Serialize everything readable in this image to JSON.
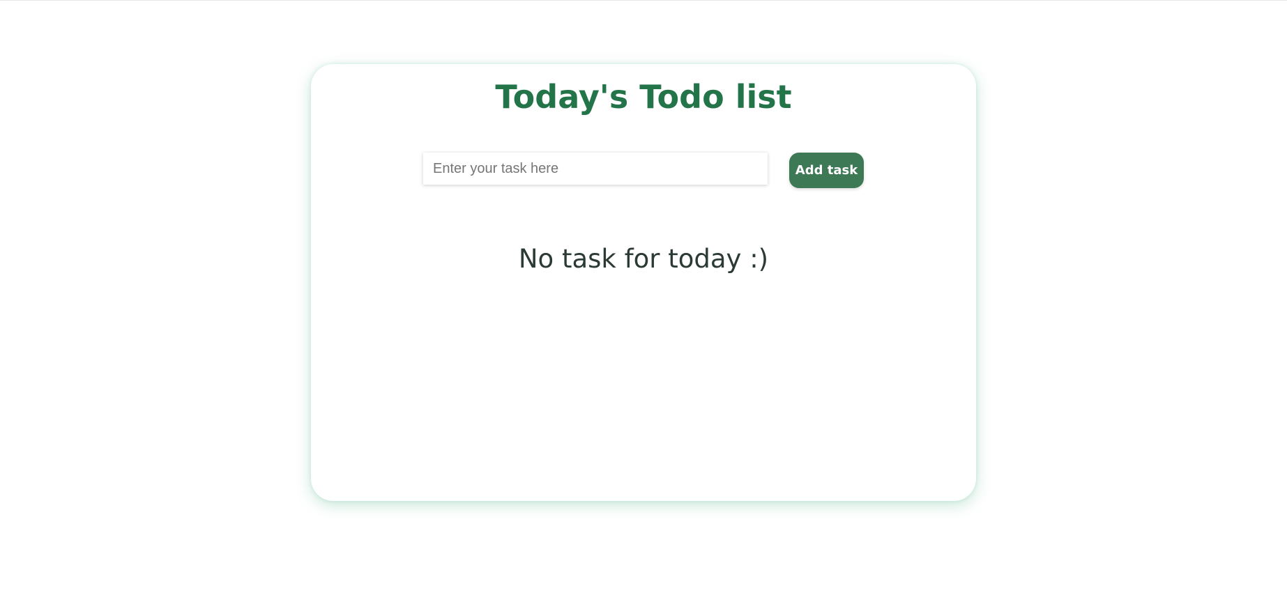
{
  "page": {
    "title": "Today's Todo list"
  },
  "input": {
    "placeholder": "Enter your task here",
    "value": ""
  },
  "buttons": {
    "add_label": "Add task"
  },
  "tasks": [],
  "empty_state": {
    "message": "No task for today :)"
  },
  "colors": {
    "title": "#24744a",
    "button_bg": "#3e7956",
    "button_text": "#ffffff",
    "message_text": "#2b3a33",
    "card_shadow": "#3caa78"
  }
}
